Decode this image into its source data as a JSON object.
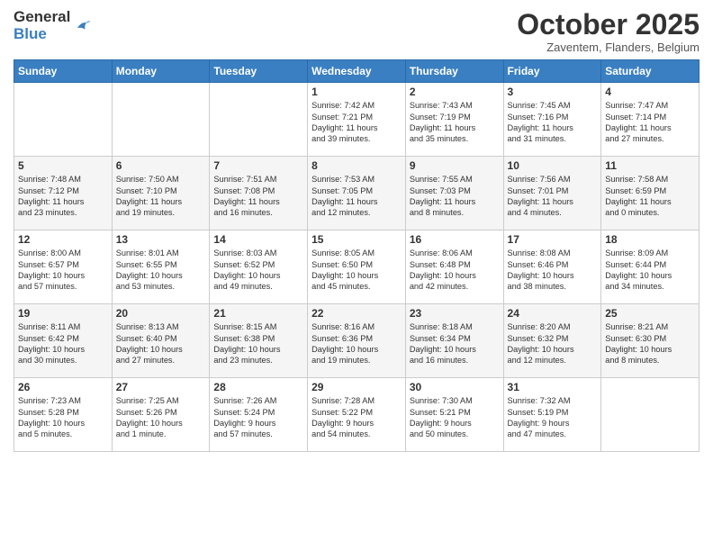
{
  "header": {
    "logo_line1": "General",
    "logo_line2": "Blue",
    "month": "October 2025",
    "location": "Zaventem, Flanders, Belgium"
  },
  "days_of_week": [
    "Sunday",
    "Monday",
    "Tuesday",
    "Wednesday",
    "Thursday",
    "Friday",
    "Saturday"
  ],
  "weeks": [
    [
      {
        "day": "",
        "info": ""
      },
      {
        "day": "",
        "info": ""
      },
      {
        "day": "",
        "info": ""
      },
      {
        "day": "1",
        "info": "Sunrise: 7:42 AM\nSunset: 7:21 PM\nDaylight: 11 hours\nand 39 minutes."
      },
      {
        "day": "2",
        "info": "Sunrise: 7:43 AM\nSunset: 7:19 PM\nDaylight: 11 hours\nand 35 minutes."
      },
      {
        "day": "3",
        "info": "Sunrise: 7:45 AM\nSunset: 7:16 PM\nDaylight: 11 hours\nand 31 minutes."
      },
      {
        "day": "4",
        "info": "Sunrise: 7:47 AM\nSunset: 7:14 PM\nDaylight: 11 hours\nand 27 minutes."
      }
    ],
    [
      {
        "day": "5",
        "info": "Sunrise: 7:48 AM\nSunset: 7:12 PM\nDaylight: 11 hours\nand 23 minutes."
      },
      {
        "day": "6",
        "info": "Sunrise: 7:50 AM\nSunset: 7:10 PM\nDaylight: 11 hours\nand 19 minutes."
      },
      {
        "day": "7",
        "info": "Sunrise: 7:51 AM\nSunset: 7:08 PM\nDaylight: 11 hours\nand 16 minutes."
      },
      {
        "day": "8",
        "info": "Sunrise: 7:53 AM\nSunset: 7:05 PM\nDaylight: 11 hours\nand 12 minutes."
      },
      {
        "day": "9",
        "info": "Sunrise: 7:55 AM\nSunset: 7:03 PM\nDaylight: 11 hours\nand 8 minutes."
      },
      {
        "day": "10",
        "info": "Sunrise: 7:56 AM\nSunset: 7:01 PM\nDaylight: 11 hours\nand 4 minutes."
      },
      {
        "day": "11",
        "info": "Sunrise: 7:58 AM\nSunset: 6:59 PM\nDaylight: 11 hours\nand 0 minutes."
      }
    ],
    [
      {
        "day": "12",
        "info": "Sunrise: 8:00 AM\nSunset: 6:57 PM\nDaylight: 10 hours\nand 57 minutes."
      },
      {
        "day": "13",
        "info": "Sunrise: 8:01 AM\nSunset: 6:55 PM\nDaylight: 10 hours\nand 53 minutes."
      },
      {
        "day": "14",
        "info": "Sunrise: 8:03 AM\nSunset: 6:52 PM\nDaylight: 10 hours\nand 49 minutes."
      },
      {
        "day": "15",
        "info": "Sunrise: 8:05 AM\nSunset: 6:50 PM\nDaylight: 10 hours\nand 45 minutes."
      },
      {
        "day": "16",
        "info": "Sunrise: 8:06 AM\nSunset: 6:48 PM\nDaylight: 10 hours\nand 42 minutes."
      },
      {
        "day": "17",
        "info": "Sunrise: 8:08 AM\nSunset: 6:46 PM\nDaylight: 10 hours\nand 38 minutes."
      },
      {
        "day": "18",
        "info": "Sunrise: 8:09 AM\nSunset: 6:44 PM\nDaylight: 10 hours\nand 34 minutes."
      }
    ],
    [
      {
        "day": "19",
        "info": "Sunrise: 8:11 AM\nSunset: 6:42 PM\nDaylight: 10 hours\nand 30 minutes."
      },
      {
        "day": "20",
        "info": "Sunrise: 8:13 AM\nSunset: 6:40 PM\nDaylight: 10 hours\nand 27 minutes."
      },
      {
        "day": "21",
        "info": "Sunrise: 8:15 AM\nSunset: 6:38 PM\nDaylight: 10 hours\nand 23 minutes."
      },
      {
        "day": "22",
        "info": "Sunrise: 8:16 AM\nSunset: 6:36 PM\nDaylight: 10 hours\nand 19 minutes."
      },
      {
        "day": "23",
        "info": "Sunrise: 8:18 AM\nSunset: 6:34 PM\nDaylight: 10 hours\nand 16 minutes."
      },
      {
        "day": "24",
        "info": "Sunrise: 8:20 AM\nSunset: 6:32 PM\nDaylight: 10 hours\nand 12 minutes."
      },
      {
        "day": "25",
        "info": "Sunrise: 8:21 AM\nSunset: 6:30 PM\nDaylight: 10 hours\nand 8 minutes."
      }
    ],
    [
      {
        "day": "26",
        "info": "Sunrise: 7:23 AM\nSunset: 5:28 PM\nDaylight: 10 hours\nand 5 minutes."
      },
      {
        "day": "27",
        "info": "Sunrise: 7:25 AM\nSunset: 5:26 PM\nDaylight: 10 hours\nand 1 minute."
      },
      {
        "day": "28",
        "info": "Sunrise: 7:26 AM\nSunset: 5:24 PM\nDaylight: 9 hours\nand 57 minutes."
      },
      {
        "day": "29",
        "info": "Sunrise: 7:28 AM\nSunset: 5:22 PM\nDaylight: 9 hours\nand 54 minutes."
      },
      {
        "day": "30",
        "info": "Sunrise: 7:30 AM\nSunset: 5:21 PM\nDaylight: 9 hours\nand 50 minutes."
      },
      {
        "day": "31",
        "info": "Sunrise: 7:32 AM\nSunset: 5:19 PM\nDaylight: 9 hours\nand 47 minutes."
      },
      {
        "day": "",
        "info": ""
      }
    ]
  ]
}
